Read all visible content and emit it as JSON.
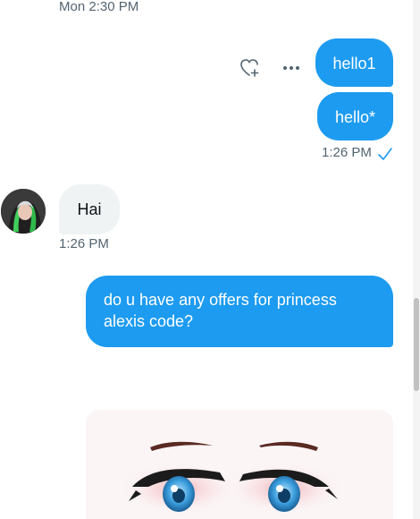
{
  "conversation": {
    "top_timestamp": "Mon 2:30 PM",
    "sent_group_1": {
      "messages": [
        "hello1",
        "hello*"
      ],
      "timestamp": "1:26 PM",
      "status_icon": "check-icon"
    },
    "received": {
      "message": "Hai",
      "timestamp": "1:26 PM",
      "avatar_icon": "avatar"
    },
    "sent_group_2": {
      "message": "do u have any offers for princess alexis code?"
    },
    "actions": {
      "react_icon": "heart-plus-icon",
      "more_icon": "more-icon"
    },
    "image_attachment": {
      "subject": "anime-eyes-image"
    }
  },
  "colors": {
    "accent": "#1d9bf0",
    "received_bubble": "#eff3f4",
    "timestamp": "#536471"
  }
}
